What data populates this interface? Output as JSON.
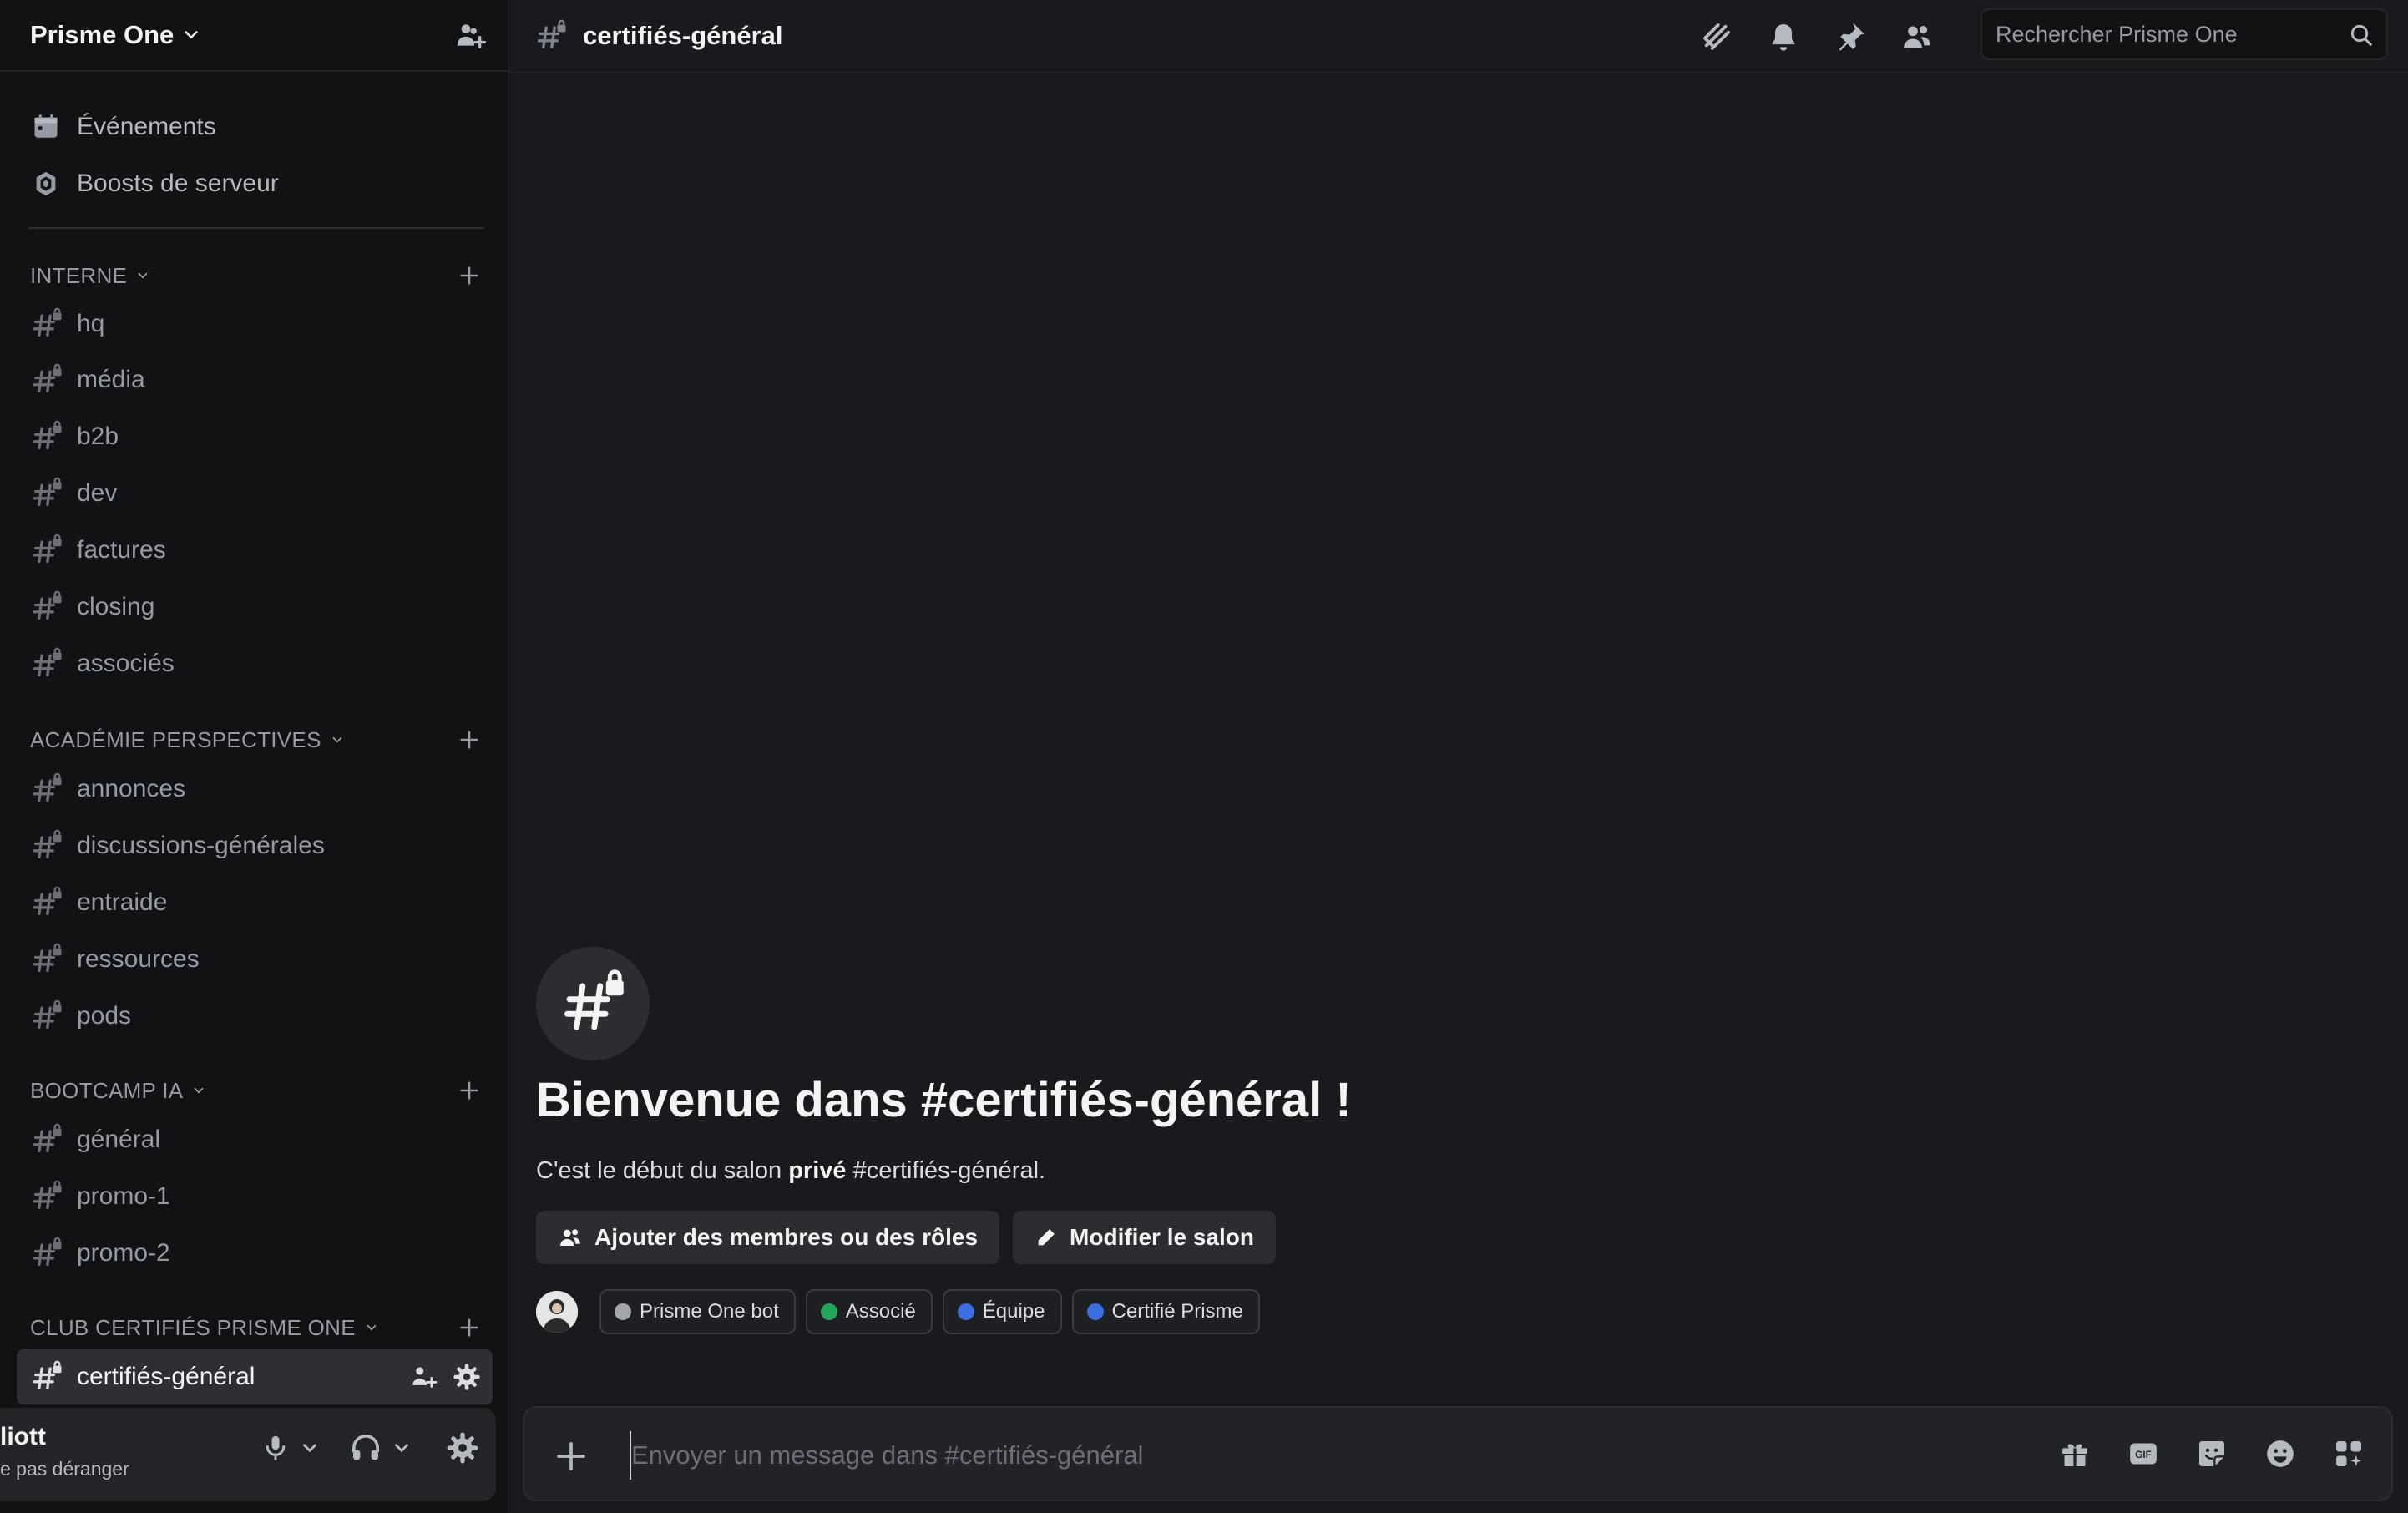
{
  "server": {
    "name": "Prisme One"
  },
  "top_items": [
    {
      "label": "Événements",
      "icon": "calendar-icon"
    },
    {
      "label": "Boosts de serveur",
      "icon": "boost-icon"
    }
  ],
  "categories": [
    {
      "name": "INTERNE",
      "channels": [
        "hq",
        "média",
        "b2b",
        "dev",
        "factures",
        "closing",
        "associés"
      ]
    },
    {
      "name": "ACADÉMIE PERSPECTIVES",
      "channels": [
        "annonces",
        "discussions-générales",
        "entraide",
        "ressources",
        "pods"
      ]
    },
    {
      "name": "BOOTCAMP IA",
      "channels": [
        "général",
        "promo-1",
        "promo-2"
      ]
    },
    {
      "name": "CLUB CERTIFIÉS PRISME ONE",
      "channels": [
        "certifiés-général"
      ]
    }
  ],
  "user": {
    "name": "liott",
    "status": "e pas déranger"
  },
  "topbar": {
    "channel": "certifiés-général"
  },
  "search": {
    "placeholder": "Rechercher Prisme One"
  },
  "welcome": {
    "title": "Bienvenue dans #certifiés-général !",
    "desc_prefix": "C'est le début du salon ",
    "desc_bold": "privé",
    "desc_suffix": " #certifiés-général.",
    "btn_add": "Ajouter des membres ou des rôles",
    "btn_edit": "Modifier le salon"
  },
  "roles": [
    {
      "name": "Prisme One bot",
      "color": "#a3a6aa"
    },
    {
      "name": "Associé",
      "color": "#23a55a"
    },
    {
      "name": "Équipe",
      "color": "#3b6fe0"
    },
    {
      "name": "Certifié Prisme",
      "color": "#3b6fe0"
    }
  ],
  "composer": {
    "placeholder": "Envoyer un message dans #certifiés-général"
  },
  "colors": {
    "background": "#1a1a1e",
    "sidebar": "#121214",
    "active_channel": "#2e2f35"
  }
}
